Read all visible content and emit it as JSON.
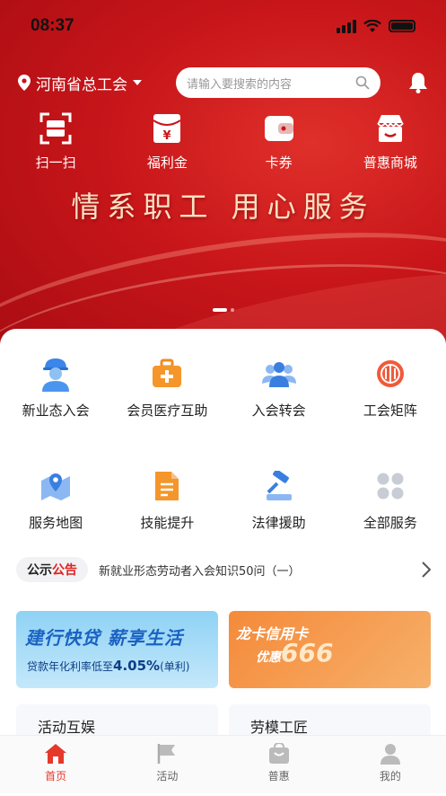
{
  "status": {
    "time": "08:37"
  },
  "header": {
    "location": "河南省总工会",
    "search_placeholder": "请输入要搜索的内容"
  },
  "quick_actions": [
    {
      "label": "扫一扫",
      "icon": "scan-icon"
    },
    {
      "label": "福利金",
      "icon": "welfare-envelope-icon"
    },
    {
      "label": "卡券",
      "icon": "wallet-icon"
    },
    {
      "label": "普惠商城",
      "icon": "store-icon"
    }
  ],
  "banner": {
    "slogan": "情系职工  用心服务",
    "active_slide": 1,
    "slide_count": 2
  },
  "services": [
    {
      "label": "新业态入会",
      "icon": "worker-icon"
    },
    {
      "label": "会员医疗互助",
      "icon": "medical-kit-icon"
    },
    {
      "label": "入会转会",
      "icon": "group-icon"
    },
    {
      "label": "工会矩阵",
      "icon": "union-emblem-icon"
    },
    {
      "label": "服务地图",
      "icon": "map-pin-icon"
    },
    {
      "label": "技能提升",
      "icon": "document-icon"
    },
    {
      "label": "法律援助",
      "icon": "gavel-icon"
    },
    {
      "label": "全部服务",
      "icon": "grid-icon"
    }
  ],
  "notice": {
    "tag_a": "公示",
    "tag_b": "公告",
    "text": "新就业形态劳动者入会知识50问（一）"
  },
  "promos": {
    "left_title": "建行快贷  薪享生活",
    "left_sub_prefix": "贷款年化利率低至",
    "left_rate": "4.05%",
    "left_sub_suffix": "(单利)",
    "right_title": "龙卡信用卡",
    "right_sub": "优惠",
    "right_number": "666"
  },
  "cards": [
    {
      "label": "活动互娱"
    },
    {
      "label": "劳模工匠"
    }
  ],
  "tabbar": [
    {
      "label": "首页",
      "icon": "home-icon",
      "active": true
    },
    {
      "label": "活动",
      "icon": "flag-icon",
      "active": false
    },
    {
      "label": "普惠",
      "icon": "shopping-bag-icon",
      "active": false
    },
    {
      "label": "我的",
      "icon": "user-icon",
      "active": false
    }
  ],
  "colors": {
    "brand_red": "#c8161a",
    "accent": "#e4392b"
  }
}
